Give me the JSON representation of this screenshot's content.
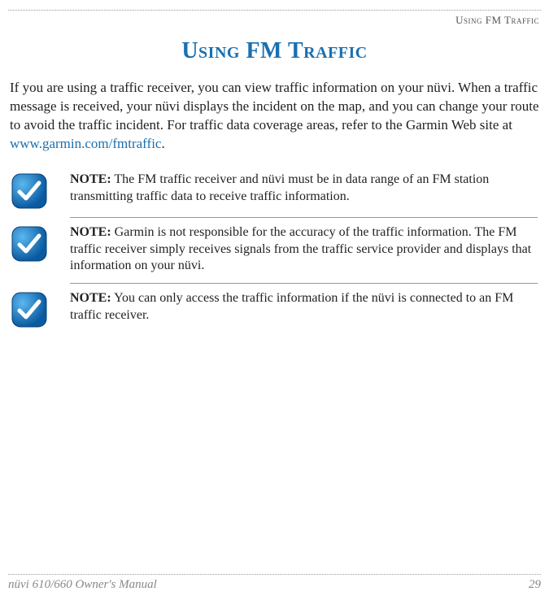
{
  "running_header": "Using FM Traffic",
  "title": "Using FM Traffic",
  "intro_text": "If you are using a traffic receiver, you can view traffic information on your nüvi. When a traffic message is received, your nüvi displays the incident on the map, and you can change your route to avoid the traffic incident. For traffic data coverage areas, refer to the Garmin Web site at ",
  "intro_link_text": "www.garmin.com/fmtraffic",
  "intro_tail": ".",
  "notes": [
    {
      "label": "NOTE:",
      "text": " The FM traffic receiver and nüvi must be in data range of an FM station transmitting traffic data to receive traffic information."
    },
    {
      "label": "NOTE:",
      "text": " Garmin is not responsible for the accuracy of the traffic information. The FM traffic receiver simply receives signals from the traffic service provider and displays that information on your nüvi."
    },
    {
      "label": "NOTE:",
      "text": " You can only access the traffic information if the nüvi is connected to an FM traffic receiver."
    }
  ],
  "footer_left": "nüvi 610/660 Owner's Manual",
  "footer_right": "29"
}
